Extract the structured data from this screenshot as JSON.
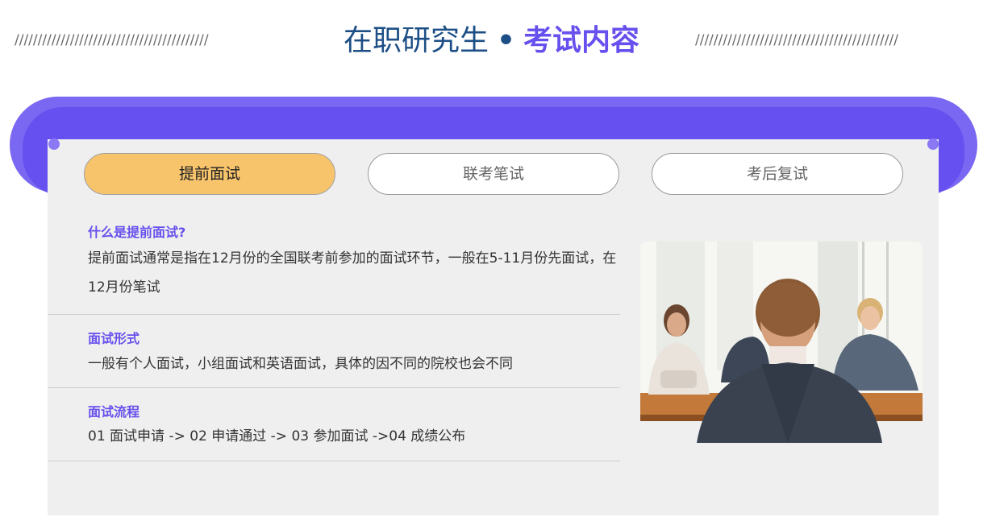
{
  "header": {
    "deco_left": "//////////////////////////////////////////",
    "deco_right": "////////////////////////////////////////////",
    "title_part1": "在职研究生",
    "separator": "•",
    "title_part2": "考试内容"
  },
  "tabs": [
    {
      "label": "提前面试",
      "active": true
    },
    {
      "label": "联考笔试",
      "active": false
    },
    {
      "label": "考后复试",
      "active": false
    }
  ],
  "sections": [
    {
      "title": "什么是提前面试?",
      "body": "提前面试通常是指在12月份的全国联考前参加的面试环节，一般在5-11月份先面试，在12月份笔试"
    },
    {
      "title": "面试形式",
      "body": "一般有个人面试，小组面试和英语面试，具体的因不同的院校也会不同"
    },
    {
      "title": "面试流程",
      "body": "01 面试申请 -> 02 申请通过 -> 03 参加面试 ->04 成绩公布"
    }
  ],
  "colors": {
    "accent_purple": "#6650ee",
    "title_blue": "#1d4f86",
    "active_tab": "#f7c46c",
    "panel_bg": "#efefef"
  },
  "image": {
    "icon": "interview-photo"
  }
}
